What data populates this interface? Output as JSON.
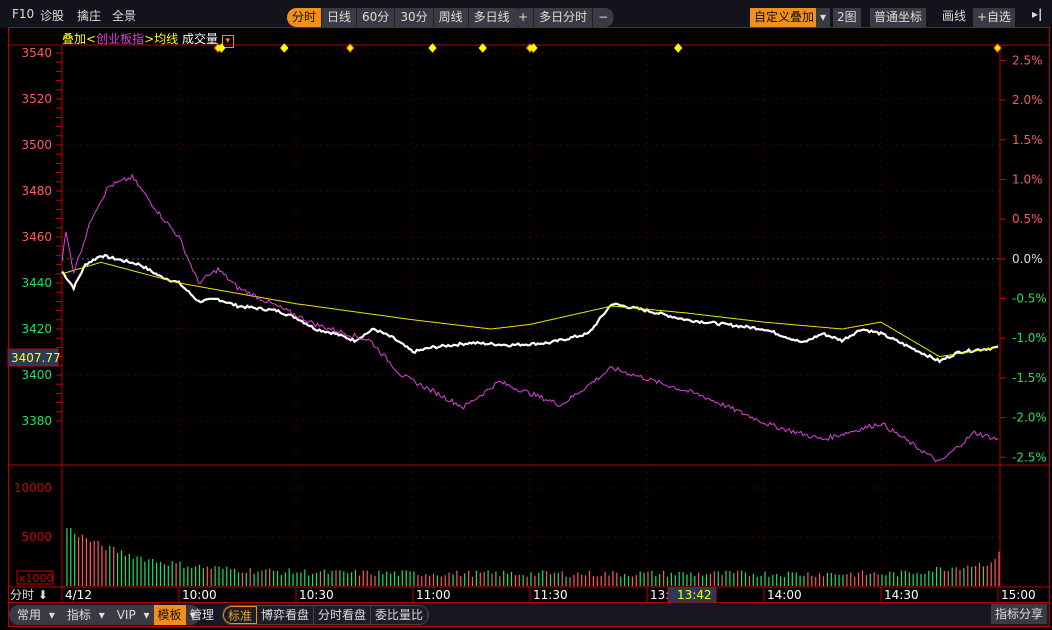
{
  "toolbar": {
    "left": [
      "F10",
      "诊股",
      "擒庄",
      "全景"
    ],
    "periods": [
      "分时",
      "日线",
      "60分",
      "30分",
      "周线",
      "多日线 ▾"
    ],
    "active_period": "分时",
    "multiday": [
      "+",
      "多日分时",
      "−"
    ],
    "right": {
      "custom_overlay": "自定义叠加",
      "two_charts": "2图",
      "coord": "普通坐标",
      "draw": "画线",
      "watch": "+自选",
      "collapse": "▸|"
    }
  },
  "legend": {
    "overlay": "叠加<",
    "index": "创业板指",
    "avg": ">均线",
    "volume": "成交量"
  },
  "cursor": {
    "price": "3407.77",
    "time": "13:42"
  },
  "bottom": {
    "menus": [
      "常用",
      "指标",
      "VIP",
      "模板"
    ],
    "active_menu": "模板",
    "manage": "管理",
    "tabs": [
      "标准",
      "博弈看盘",
      "分时看盘",
      "委比量比"
    ],
    "active_tab": "标准",
    "share": "指标分享",
    "period_label": "分时",
    "volume_unit": "x1000"
  },
  "colors": {
    "price": "#ffffff",
    "avg": "#e8e800",
    "overlay": "#e040e0",
    "up": "#ff5a5a",
    "down": "#20e060",
    "grid": "#7a0000"
  },
  "chart_data": {
    "type": "line",
    "date": "4/12",
    "x_ticks": [
      "4/12",
      "10:00",
      "10:30",
      "11:00",
      "11:30",
      "13:30",
      "14:00",
      "14:30",
      "15:00"
    ],
    "y_ticks": [
      3540,
      3520,
      3500,
      3480,
      3460,
      3440,
      3420,
      3400,
      3380
    ],
    "pct_ticks": [
      "2.5%",
      "2.0%",
      "1.5%",
      "1.0%",
      "0.5%",
      "0.0%",
      "-0.5%",
      "-1.0%",
      "-1.5%",
      "-2.0%",
      "-2.5%"
    ],
    "prev_close": 3450.5,
    "ylim": [
      3538,
      3378
    ],
    "vol_ticks": [
      10000,
      5000
    ],
    "series": [
      {
        "name": "price",
        "points": [
          [
            0,
            3445
          ],
          [
            3,
            3438
          ],
          [
            6,
            3448
          ],
          [
            10,
            3452
          ],
          [
            15,
            3450
          ],
          [
            20,
            3448
          ],
          [
            25,
            3443
          ],
          [
            30,
            3440
          ],
          [
            35,
            3432
          ],
          [
            40,
            3433
          ],
          [
            45,
            3430
          ],
          [
            55,
            3428
          ],
          [
            60,
            3425
          ],
          [
            65,
            3420
          ],
          [
            70,
            3418
          ],
          [
            75,
            3415
          ],
          [
            80,
            3420
          ],
          [
            85,
            3416
          ],
          [
            90,
            3410
          ],
          [
            95,
            3412
          ],
          [
            105,
            3414
          ],
          [
            115,
            3413
          ],
          [
            125,
            3414
          ],
          [
            135,
            3418
          ],
          [
            141,
            3431
          ],
          [
            150,
            3428
          ],
          [
            160,
            3424
          ],
          [
            170,
            3422
          ],
          [
            180,
            3420
          ],
          [
            190,
            3414
          ],
          [
            195,
            3418
          ],
          [
            200,
            3415
          ],
          [
            205,
            3420
          ],
          [
            210,
            3418
          ],
          [
            215,
            3414
          ],
          [
            220,
            3410
          ],
          [
            225,
            3406
          ],
          [
            230,
            3410
          ],
          [
            240,
            3412
          ]
        ]
      },
      {
        "name": "avg",
        "points": [
          [
            0,
            3444
          ],
          [
            10,
            3449
          ],
          [
            30,
            3440
          ],
          [
            60,
            3431
          ],
          [
            90,
            3424
          ],
          [
            110,
            3420
          ],
          [
            120,
            3422
          ],
          [
            141,
            3430
          ],
          [
            160,
            3427
          ],
          [
            180,
            3423
          ],
          [
            200,
            3420
          ],
          [
            210,
            3423
          ],
          [
            225,
            3408
          ],
          [
            240,
            3412
          ]
        ]
      },
      {
        "name": "chinext",
        "points": [
          [
            0,
            3450
          ],
          [
            1,
            3462
          ],
          [
            3,
            3445
          ],
          [
            8,
            3470
          ],
          [
            12,
            3482
          ],
          [
            18,
            3486
          ],
          [
            25,
            3470
          ],
          [
            30,
            3460
          ],
          [
            35,
            3440
          ],
          [
            40,
            3446
          ],
          [
            45,
            3438
          ],
          [
            55,
            3430
          ],
          [
            65,
            3422
          ],
          [
            79,
            3415
          ],
          [
            87,
            3400
          ],
          [
            103,
            3386
          ],
          [
            112,
            3397
          ],
          [
            128,
            3387
          ],
          [
            141,
            3403
          ],
          [
            164,
            3391
          ],
          [
            182,
            3378
          ],
          [
            195,
            3372
          ],
          [
            210,
            3379
          ],
          [
            225,
            3362
          ],
          [
            234,
            3375
          ],
          [
            240,
            3372
          ]
        ]
      }
    ],
    "event_minutes": [
      40,
      41,
      57,
      74,
      95,
      108,
      120,
      121,
      158,
      240
    ]
  }
}
